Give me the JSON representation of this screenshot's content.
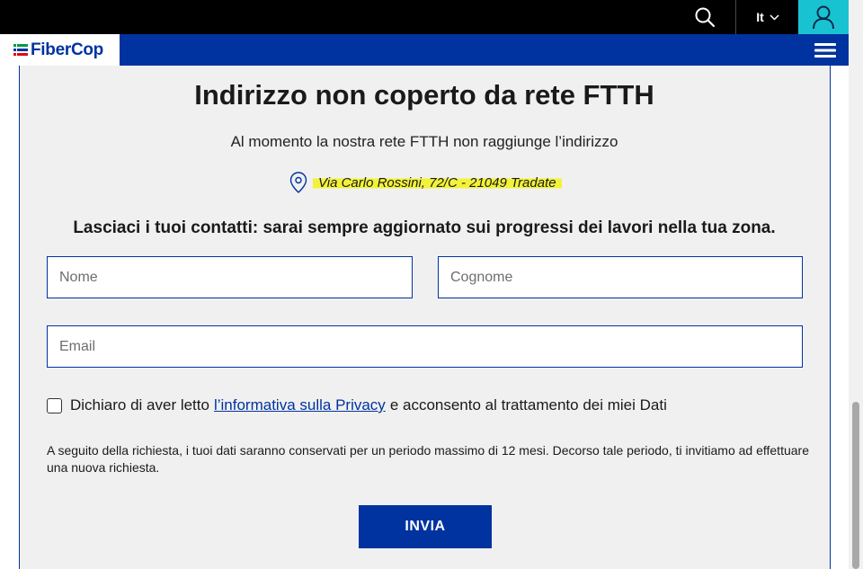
{
  "header": {
    "language": "It",
    "icons": {
      "search": "search-icon",
      "language_chevron": "chevron-down-icon",
      "user": "user-icon",
      "menu": "hamburger-menu-icon"
    }
  },
  "nav": {
    "logo_text": "FiberCop"
  },
  "content": {
    "title": "Indirizzo non coperto da rete FTTH",
    "subtitle": "Al momento la nostra rete FTTH non raggiunge l’indirizzo",
    "address": "Via Carlo Rossini, 72/C - 21049 Tradate",
    "cta": "Lasciaci i tuoi contatti: sarai sempre aggiornato sui progressi dei lavori nella tua zona."
  },
  "form": {
    "nome_placeholder": "Nome",
    "nome_value": "",
    "cognome_placeholder": "Cognome",
    "cognome_value": "",
    "email_placeholder": "Email",
    "email_value": "",
    "consent_prefix": "Dichiaro di aver letto",
    "consent_link": "l’informativa sulla Privacy",
    "consent_suffix": "e acconsento al trattamento dei miei Dati",
    "consent_checked": false,
    "note": "A seguito della richiesta, i tuoi dati saranno conservati per un periodo massimo di 12 mesi. Decorso tale periodo, ti invitiamo ad effettuare una nuova richiesta.",
    "submit_label": "INVIA"
  },
  "colors": {
    "brand_blue": "#0033a0",
    "accent_cyan": "#19c2d1",
    "highlight_yellow": "#f2f23a",
    "logo_green": "#009a44",
    "logo_red": "#e30613"
  }
}
